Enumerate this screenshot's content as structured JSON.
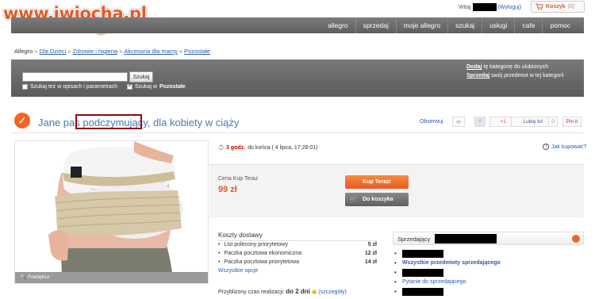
{
  "watermark": "www.iwiocha.pl",
  "brand": "allegro",
  "header": {
    "greeting": "Witaj",
    "logout": "(Wyloguj)",
    "cart_label": "Koszyk",
    "cart_count": "(0)"
  },
  "nav": [
    "allegro",
    "sprzedaj",
    "moje allegro",
    "szukaj",
    "usługi",
    "cafe",
    "pomoc"
  ],
  "breadcrumb": [
    "Allegro",
    "Dla Dzieci",
    "Zdrowie i higiena",
    "Akcesoria dla mamy",
    "Pozostałe"
  ],
  "search": {
    "placeholder": "",
    "button": "Szukaj",
    "opt1": "Szukaj też w opisach i parametrach",
    "opt2_prefix": "Szukaj w",
    "opt2_category": "Pozostałe",
    "opt2_checked": true,
    "add_link": "Dodaj",
    "add_text": " tę kategorię do ulubionych",
    "sell_link": "Sprzedaj",
    "sell_text": " swój przedmiot w tej kategorii"
  },
  "product": {
    "title": "Jane pas podczymujący, dla kobiety w ciąży",
    "observe": "Obserwuj",
    "gplus": "+1",
    "like": "Lubię to!",
    "like_count": "0",
    "pin": "Pin it",
    "image_caption": "Powiększ"
  },
  "auction": {
    "time_left": "3 godz.",
    "end_text": "do końca ( 4 lipca, 17:28:01)",
    "how_bought": "Jak kupować?",
    "price_label": "Cena Kup Teraz",
    "price": "99 zł",
    "buy_now": "Kup Teraz!",
    "add_to_cart": "Do koszyka"
  },
  "shipping": {
    "title": "Koszty dostawy",
    "rows": [
      {
        "name": "List polecony priorytetowy",
        "price": "5 zł"
      },
      {
        "name": "Paczka pocztowa ekonomiczna",
        "price": "12 zł"
      },
      {
        "name": "Paczka pocztowa priorytetowa",
        "price": "14 zł"
      }
    ],
    "all_options": "Wszystkie opcje",
    "realization_label": "Przybliżony czas realizacji:",
    "realization_value": "do 2 dni",
    "details": "(szczegóły)"
  },
  "seller": {
    "label": "Sprzedający",
    "all_items": "Wszystkie przedmioty sprzedającego",
    "ask": "Pytanie do sprzedającego"
  },
  "colors": {
    "accent": "#e35a27",
    "link": "#2a5db0",
    "nav_bg": "#6b6b6b",
    "highlight_box": "#8b0d0d"
  }
}
